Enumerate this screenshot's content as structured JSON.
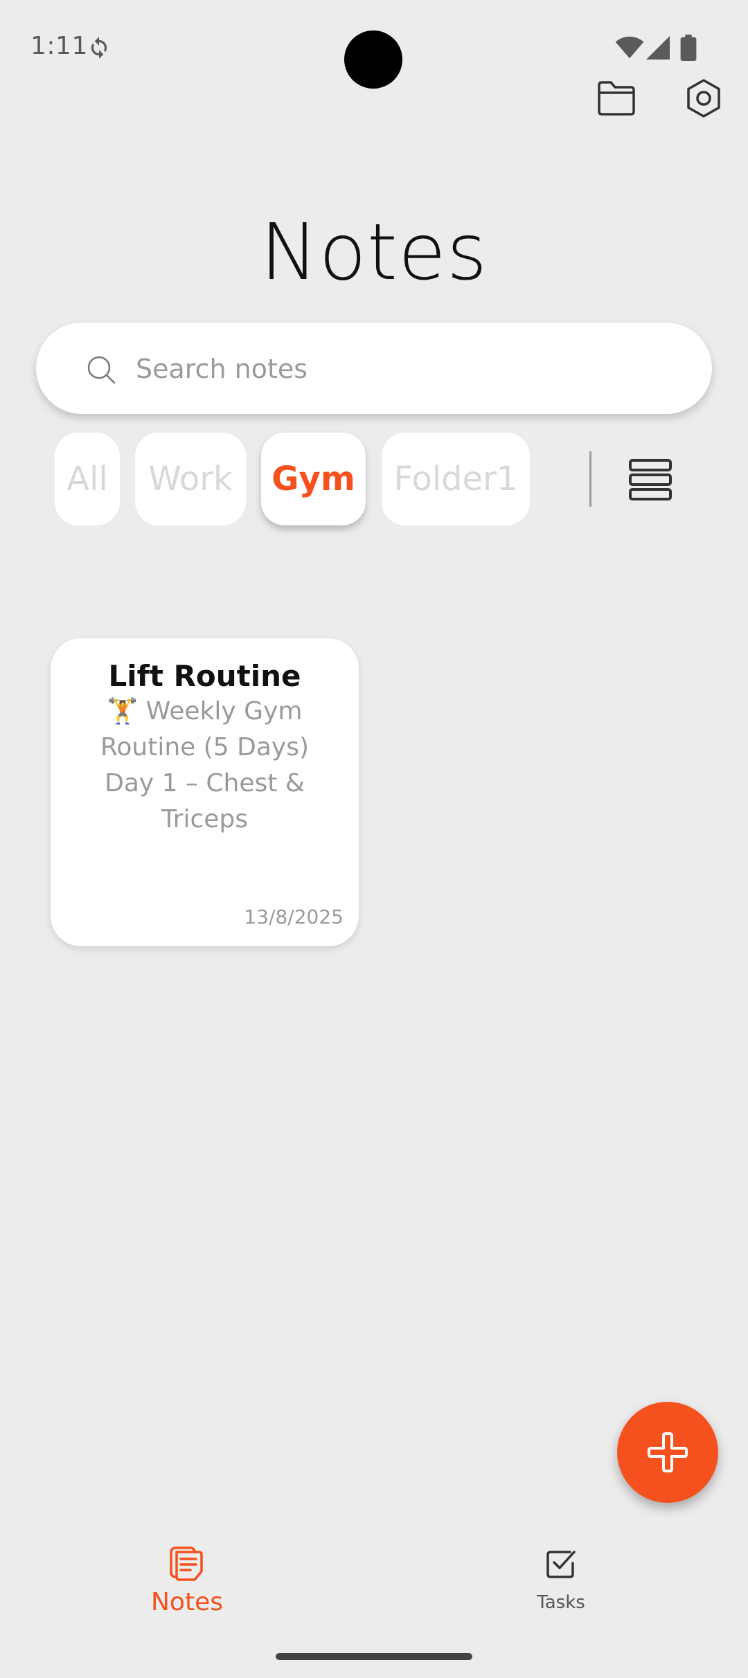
{
  "status_bar": {
    "time": "1:11",
    "icons": [
      "sync-icon",
      "wifi-icon",
      "signal-icon",
      "battery-icon"
    ]
  },
  "top_actions": {
    "icons": [
      "folder-icon",
      "settings-icon"
    ]
  },
  "page": {
    "title": "Notes"
  },
  "search": {
    "placeholder": "Search notes",
    "value": ""
  },
  "folders": {
    "chips": [
      "All",
      "Work",
      "Gym",
      "Folder1"
    ],
    "selected": "Gym",
    "view_toggle_icon": "list-view-icon"
  },
  "notes": [
    {
      "title": "Lift Routine",
      "preview": "🏋️ Weekly Gym\nRoutine (5 Days)\nDay 1 – Chest &\nTriceps",
      "date": "13/8/2025"
    }
  ],
  "fab": {
    "icon": "plus-icon"
  },
  "bottom_nav": {
    "items": [
      {
        "label": "Notes",
        "icon": "notes-icon",
        "active": true
      },
      {
        "label": "Tasks",
        "icon": "tasks-icon",
        "active": false
      }
    ]
  },
  "colors": {
    "accent": "#f4511e",
    "background": "#ececec",
    "card": "#ffffff",
    "muted_text": "#9a9a9a",
    "inactive_chip_text": "#d8d8d8"
  }
}
